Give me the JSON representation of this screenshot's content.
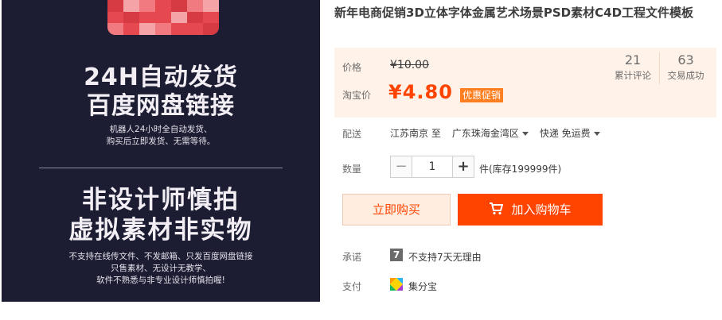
{
  "image": {
    "heading_1": "24H自动发货",
    "heading_2": "百度网盘链接",
    "sub_1": "机器人24小时全自动发货、",
    "sub_2": "购买后立即发货、无需等待。",
    "heading_3": "非设计师慎拍",
    "heading_4": "虚拟素材非实物",
    "note_1": "不支持在线传文件、不发邮箱、只发百度网盘链接",
    "note_2": "只售素材、无设计无教学、",
    "note_3": "软件不熟悉与非专业设计师慎拍喔!"
  },
  "product": {
    "title": "新年电商促销3D立体字体金属艺术场景PSD素材C4D工程文件模板"
  },
  "price": {
    "label": "价格",
    "original": "¥10.00",
    "promo_label": "淘宝价",
    "promo": "¥4.80",
    "badge": "优惠促销"
  },
  "stats": {
    "reviews_count": "21",
    "reviews_label": "累计评论",
    "deals_count": "63",
    "deals_label": "交易成功"
  },
  "shipping": {
    "label": "配送",
    "from": "江苏南京 至",
    "to": "广东珠海金湾区",
    "method": "快递 免运费"
  },
  "quantity": {
    "label": "数量",
    "minus": "−",
    "value": "1",
    "plus": "+",
    "stock": "件(库存199999件)"
  },
  "actions": {
    "buy_now": "立即购买",
    "add_cart": "加入购物车"
  },
  "promise": {
    "label": "承诺",
    "icon_text": "7",
    "text": "不支持7天无理由"
  },
  "payment": {
    "label": "支付",
    "text": "集分宝"
  },
  "colors": {
    "accent": "#ff4400",
    "badge": "#ff7e20",
    "price_panel_bg": "#fff2e8",
    "image_bg": "#1c1d33"
  }
}
